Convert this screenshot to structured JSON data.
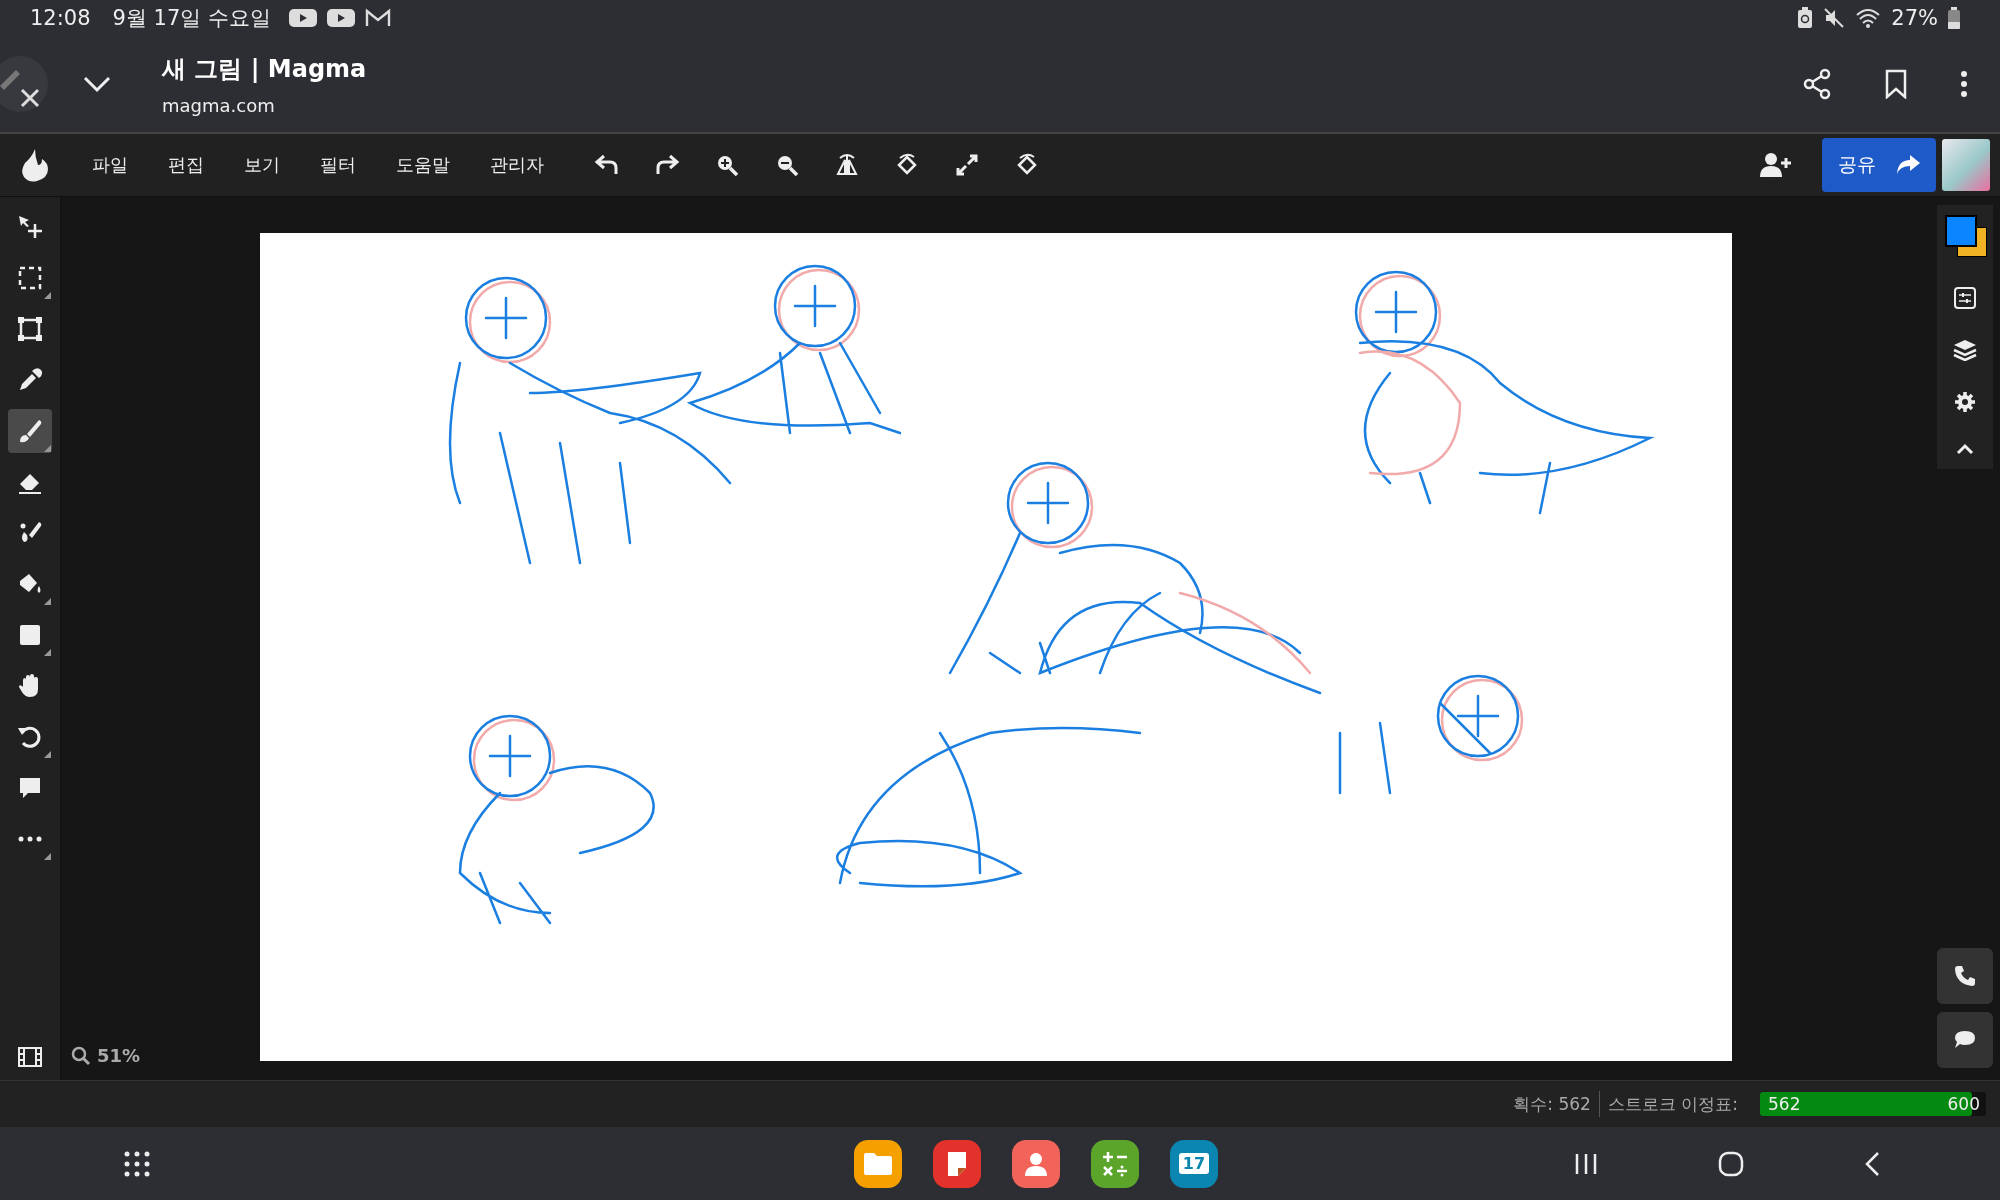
{
  "status_bar": {
    "time": "12:08",
    "date": "9월 17일 수요일",
    "battery": "27%"
  },
  "browser": {
    "title": "새 그림 | Magma",
    "url": "magma.com"
  },
  "menu": [
    "파일",
    "편집",
    "보기",
    "필터",
    "도움말",
    "관리자"
  ],
  "share_button": "공유",
  "tools": [
    {
      "selected": false,
      "submenu": false
    },
    {
      "selected": false,
      "submenu": true
    },
    {
      "selected": false,
      "submenu": false
    },
    {
      "selected": false,
      "submenu": false
    },
    {
      "selected": true,
      "submenu": true
    },
    {
      "selected": false,
      "submenu": false
    },
    {
      "selected": false,
      "submenu": false
    },
    {
      "selected": false,
      "submenu": true
    },
    {
      "selected": false,
      "submenu": true
    },
    {
      "selected": false,
      "submenu": false
    },
    {
      "selected": false,
      "submenu": true
    },
    {
      "selected": false,
      "submenu": false
    },
    {
      "selected": false,
      "submenu": true
    }
  ],
  "zoom": "51%",
  "footer": {
    "stroke_count": "획수: 562",
    "stroke_meter_label": "스트로크 이정표:",
    "meter_value": "562",
    "meter_max": "600",
    "level": 0.937
  },
  "dock": {
    "calendar_day": "17"
  }
}
